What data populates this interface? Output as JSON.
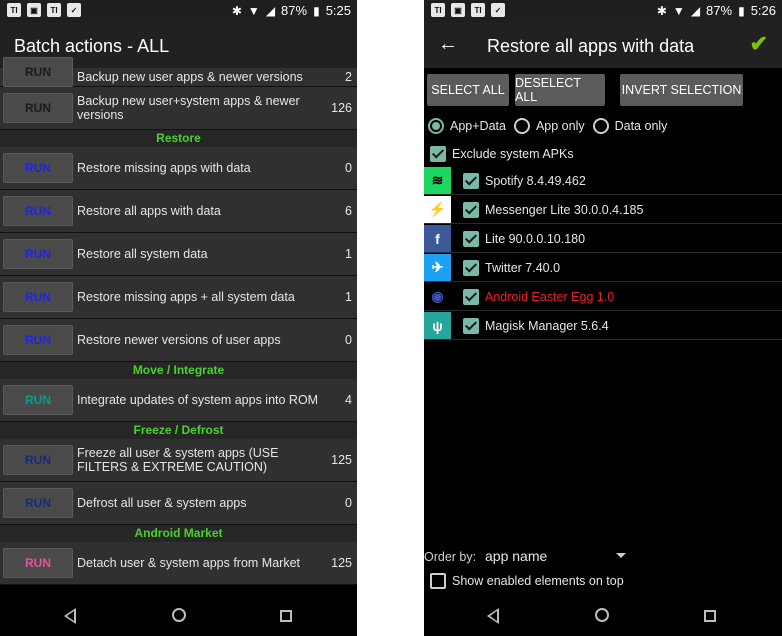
{
  "status_left": {
    "time": "5:25",
    "battery": "87%"
  },
  "status_right": {
    "time": "5:26",
    "battery": "87%"
  },
  "status_icons": [
    "bluetooth-icon",
    "wifi-icon",
    "signal-icon",
    "battery-icon"
  ],
  "left": {
    "title": "Batch actions - ALL",
    "run_label": "RUN",
    "rows": [
      {
        "kind": "action",
        "label": "Backup new user apps & newer versions",
        "count": "2",
        "color": "#1a1a1a"
      },
      {
        "kind": "action",
        "label": "Backup new user+system apps & newer versions",
        "count": "126",
        "color": "#1a1a1a"
      },
      {
        "kind": "section",
        "label": "Restore"
      },
      {
        "kind": "action",
        "label": "Restore missing apps with data",
        "count": "0",
        "color": "#2222ee"
      },
      {
        "kind": "action",
        "label": "Restore all apps with data",
        "count": "6",
        "color": "#2222ee"
      },
      {
        "kind": "action",
        "label": "Restore all system data",
        "count": "1",
        "color": "#2222ee"
      },
      {
        "kind": "action",
        "label": "Restore missing apps + all system data",
        "count": "1",
        "color": "#2222ee"
      },
      {
        "kind": "action",
        "label": "Restore newer versions of user apps",
        "count": "0",
        "color": "#2222ee"
      },
      {
        "kind": "section",
        "label": "Move / Integrate"
      },
      {
        "kind": "action",
        "label": "Integrate updates of system apps into ROM",
        "count": "4",
        "color": "#00a08a"
      },
      {
        "kind": "section",
        "label": "Freeze / Defrost"
      },
      {
        "kind": "action",
        "label": "Freeze all user & system apps (USE FILTERS & EXTREME CAUTION)",
        "count": "125",
        "color": "#1a2a7a"
      },
      {
        "kind": "action",
        "label": "Defrost all user & system apps",
        "count": "0",
        "color": "#1a2a7a"
      },
      {
        "kind": "section",
        "label": "Android Market"
      },
      {
        "kind": "action",
        "label": "Detach user & system apps from Market",
        "count": "125",
        "color": "#e8509a"
      }
    ]
  },
  "right": {
    "title": "Restore all apps with data",
    "buttons": [
      "SELECT ALL",
      "DESELECT ALL",
      "INVERT SELECTION"
    ],
    "radios": [
      {
        "label": "App+Data",
        "checked": true
      },
      {
        "label": "App only",
        "checked": false
      },
      {
        "label": "Data only",
        "checked": false
      }
    ],
    "exclude_label": "Exclude system APKs",
    "apps": [
      {
        "label": "Spotify 8.4.49.462",
        "icon": "spotify-icon",
        "bg": "#1ed760",
        "fg": "#000",
        "glyph": "≋",
        "red": false
      },
      {
        "label": "Messenger Lite 30.0.0.4.185",
        "icon": "messenger-icon",
        "bg": "#ffffff",
        "fg": "#1877f2",
        "glyph": "⚡",
        "red": false
      },
      {
        "label": "Lite 90.0.0.10.180",
        "icon": "facebook-icon",
        "bg": "#3b5998",
        "fg": "#fff",
        "glyph": "f",
        "red": false
      },
      {
        "label": "Twitter 7.40.0",
        "icon": "twitter-icon",
        "bg": "#1da1f2",
        "fg": "#fff",
        "glyph": "✈",
        "red": false
      },
      {
        "label": "Android Easter Egg 1.0",
        "icon": "easter-egg-icon",
        "bg": "#000",
        "fg": "#3f51b5",
        "glyph": "◉",
        "red": true
      },
      {
        "label": "Magisk Manager 5.6.4",
        "icon": "magisk-icon",
        "bg": "#26a69a",
        "fg": "#fff",
        "glyph": "ψ",
        "red": false
      }
    ],
    "order_label": "Order by:",
    "order_value": "app name",
    "show_enabled_label": "Show enabled elements on top"
  }
}
